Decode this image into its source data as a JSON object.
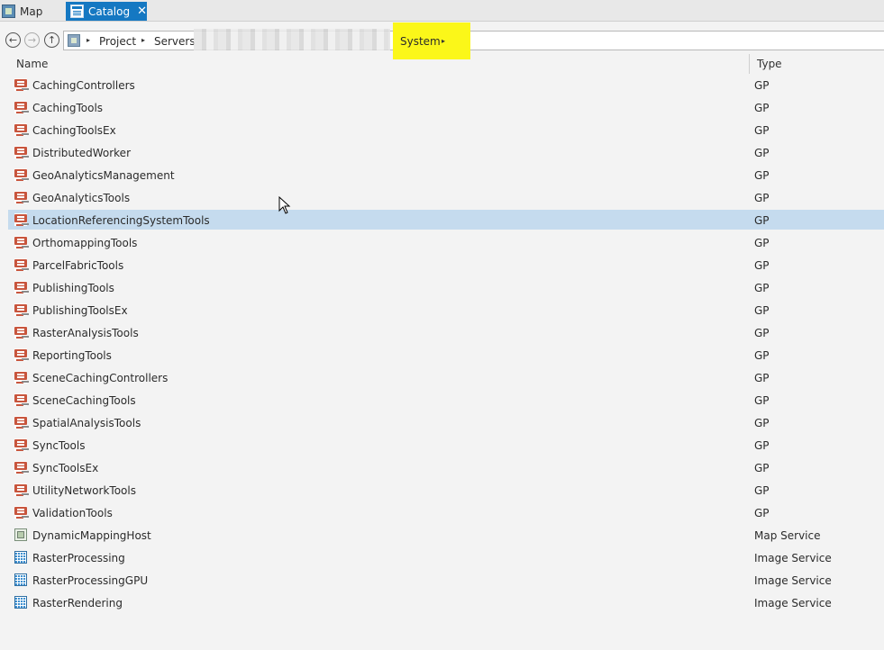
{
  "tabs": [
    {
      "label": "Map",
      "icon": "map-icon"
    },
    {
      "label": "Catalog",
      "icon": "catalog-icon",
      "active": true,
      "close": "✕"
    }
  ],
  "breadcrumb": {
    "items": [
      "Project",
      "Servers",
      "System"
    ],
    "separator": "▸",
    "highlight_color": "#fbf719"
  },
  "columns": {
    "name": "Name",
    "type": "Type"
  },
  "rows": [
    {
      "name": "CachingControllers",
      "type": "GP",
      "icon": "gp-service-icon"
    },
    {
      "name": "CachingTools",
      "type": "GP",
      "icon": "gp-service-icon"
    },
    {
      "name": "CachingToolsEx",
      "type": "GP",
      "icon": "gp-service-icon"
    },
    {
      "name": "DistributedWorker",
      "type": "GP",
      "icon": "gp-service-icon"
    },
    {
      "name": "GeoAnalyticsManagement",
      "type": "GP",
      "icon": "gp-service-icon"
    },
    {
      "name": "GeoAnalyticsTools",
      "type": "GP",
      "icon": "gp-service-icon"
    },
    {
      "name": "LocationReferencingSystemTools",
      "type": "GP",
      "icon": "gp-service-icon",
      "selected": true
    },
    {
      "name": "OrthomappingTools",
      "type": "GP",
      "icon": "gp-service-icon"
    },
    {
      "name": "ParcelFabricTools",
      "type": "GP",
      "icon": "gp-service-icon"
    },
    {
      "name": "PublishingTools",
      "type": "GP",
      "icon": "gp-service-icon"
    },
    {
      "name": "PublishingToolsEx",
      "type": "GP",
      "icon": "gp-service-icon"
    },
    {
      "name": "RasterAnalysisTools",
      "type": "GP",
      "icon": "gp-service-icon"
    },
    {
      "name": "ReportingTools",
      "type": "GP",
      "icon": "gp-service-icon"
    },
    {
      "name": "SceneCachingControllers",
      "type": "GP",
      "icon": "gp-service-icon"
    },
    {
      "name": "SceneCachingTools",
      "type": "GP",
      "icon": "gp-service-icon"
    },
    {
      "name": "SpatialAnalysisTools",
      "type": "GP",
      "icon": "gp-service-icon"
    },
    {
      "name": "SyncTools",
      "type": "GP",
      "icon": "gp-service-icon"
    },
    {
      "name": "SyncToolsEx",
      "type": "GP",
      "icon": "gp-service-icon"
    },
    {
      "name": "UtilityNetworkTools",
      "type": "GP",
      "icon": "gp-service-icon"
    },
    {
      "name": "ValidationTools",
      "type": "GP",
      "icon": "gp-service-icon"
    },
    {
      "name": "DynamicMappingHost",
      "type": "Map Service",
      "icon": "map-service-icon"
    },
    {
      "name": "RasterProcessing",
      "type": "Image Service",
      "icon": "image-service-icon"
    },
    {
      "name": "RasterProcessingGPU",
      "type": "Image Service",
      "icon": "image-service-icon"
    },
    {
      "name": "RasterRendering",
      "type": "Image Service",
      "icon": "image-service-icon"
    }
  ],
  "colors": {
    "tab_active": "#1578c2",
    "selection": "#c5dbee",
    "gp_icon": "#c8553d",
    "image_icon": "#3d8fd0"
  }
}
